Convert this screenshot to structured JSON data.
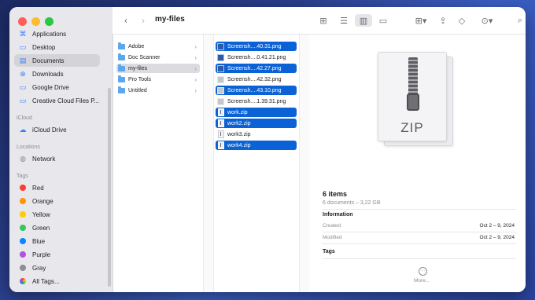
{
  "window": {
    "title": "my-files"
  },
  "sidebar": {
    "favorites": [
      {
        "label": "Applications",
        "icon": "applications-icon"
      },
      {
        "label": "Desktop",
        "icon": "desktop-icon"
      },
      {
        "label": "Documents",
        "icon": "documents-icon",
        "selected": true
      },
      {
        "label": "Downloads",
        "icon": "downloads-icon"
      },
      {
        "label": "Google Drive",
        "icon": "folder-icon"
      },
      {
        "label": "Creative Cloud Files P...",
        "icon": "folder-icon"
      }
    ],
    "icloud_heading": "iCloud",
    "icloud": [
      {
        "label": "iCloud Drive",
        "icon": "cloud-icon"
      }
    ],
    "locations_heading": "Locations",
    "locations": [
      {
        "label": "Network",
        "icon": "globe-icon"
      }
    ],
    "tags_heading": "Tags",
    "tags": [
      {
        "label": "Red",
        "color": "#ff3b30"
      },
      {
        "label": "Orange",
        "color": "#ff9500"
      },
      {
        "label": "Yellow",
        "color": "#ffcc00"
      },
      {
        "label": "Green",
        "color": "#34c759"
      },
      {
        "label": "Blue",
        "color": "#0a84ff"
      },
      {
        "label": "Purple",
        "color": "#af52de"
      },
      {
        "label": "Gray",
        "color": "#8e8e93"
      },
      {
        "label": "All Tags...",
        "color": "all"
      }
    ]
  },
  "column1": [
    {
      "label": "Adobe"
    },
    {
      "label": "Doc Scanner"
    },
    {
      "label": "my-files",
      "selected": true
    },
    {
      "label": "Pro Tools"
    },
    {
      "label": "Untitled"
    }
  ],
  "column2": [
    {
      "label": "Screensh....40.31.png",
      "kind": "png",
      "selected": true
    },
    {
      "label": "Screensh....0.41.21.png",
      "kind": "png-light",
      "selected": false
    },
    {
      "label": "Screensh....42.27.png",
      "kind": "png",
      "selected": true
    },
    {
      "label": "Screensh....42.32.png",
      "kind": "png-light",
      "selected": false
    },
    {
      "label": "Screensh....43.10.png",
      "kind": "png",
      "selected": true
    },
    {
      "label": "Screensh....1.39.31.png",
      "kind": "png-light",
      "selected": false
    },
    {
      "label": "work.zip",
      "kind": "zip",
      "selected": true
    },
    {
      "label": "work2.zip",
      "kind": "zip",
      "selected": true
    },
    {
      "label": "work3.zip",
      "kind": "zip",
      "selected": false
    },
    {
      "label": "work4.zip",
      "kind": "zip",
      "selected": true
    }
  ],
  "preview": {
    "icon_label": "ZIP",
    "count": "6 items",
    "subtitle": "6 documents – 3,22 GB",
    "information_heading": "Information",
    "created_label": "Created",
    "created_value": "Oct 2 – 9, 2024",
    "modified_label": "Modified",
    "modified_value": "Oct 2 – 9, 2024",
    "tags_heading": "Tags",
    "more_label": "More..."
  }
}
